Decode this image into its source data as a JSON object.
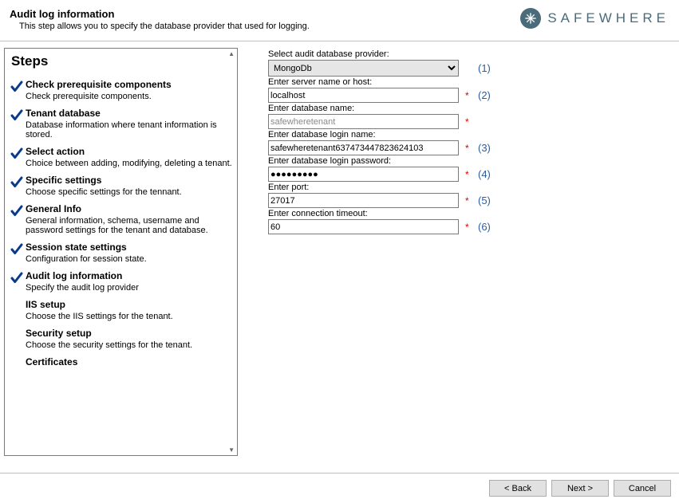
{
  "header": {
    "title": "Audit log information",
    "subtitle": "This step allows you to specify the database provider that used for logging.",
    "brand": "SAFEWHERE"
  },
  "sidebar": {
    "heading": "Steps",
    "items": [
      {
        "title": "Check prerequisite components",
        "desc": "Check prerequisite components.",
        "done": true
      },
      {
        "title": "Tenant database",
        "desc": "Database information where tenant information is stored.",
        "done": true
      },
      {
        "title": "Select action",
        "desc": "Choice between adding, modifying, deleting a tenant.",
        "done": true
      },
      {
        "title": "Specific settings",
        "desc": "Choose specific settings for the tennant.",
        "done": true
      },
      {
        "title": "General Info",
        "desc": "General information, schema, username and password settings for the tenant and database.",
        "done": true
      },
      {
        "title": "Session state settings",
        "desc": "Configuration for session state.",
        "done": true
      },
      {
        "title": "Audit log information",
        "desc": "Specify the audit log provider",
        "done": true
      },
      {
        "title": "IIS setup",
        "desc": "Choose the IIS settings for the tenant.",
        "done": false
      },
      {
        "title": "Security setup",
        "desc": "Choose the security settings for the tenant.",
        "done": false
      },
      {
        "title": "Certificates",
        "desc": "",
        "done": false
      }
    ]
  },
  "form": {
    "provider": {
      "label": "Select audit database provider:",
      "value": "MongoDb",
      "annotation": "(1)"
    },
    "host": {
      "label": "Enter server name or host:",
      "value": "localhost",
      "asterisk": "*",
      "annotation": "(2)"
    },
    "dbname": {
      "label": "Enter database name:",
      "value": "safewheretenant",
      "asterisk": "*",
      "annotation": ""
    },
    "login": {
      "label": "Enter database login name:",
      "value": "safewheretenant637473447823624103",
      "asterisk": "*",
      "annotation": "(3)"
    },
    "password": {
      "label": "Enter database login password:",
      "value": "●●●●●●●●●",
      "asterisk": "*",
      "annotation": "(4)"
    },
    "port": {
      "label": "Enter port:",
      "value": "27017",
      "asterisk": "*",
      "annotation": "(5)"
    },
    "timeout": {
      "label": "Enter connection timeout:",
      "value": "60",
      "asterisk": "*",
      "annotation": "(6)"
    }
  },
  "footer": {
    "back": "< Back",
    "next": "Next >",
    "cancel": "Cancel"
  }
}
